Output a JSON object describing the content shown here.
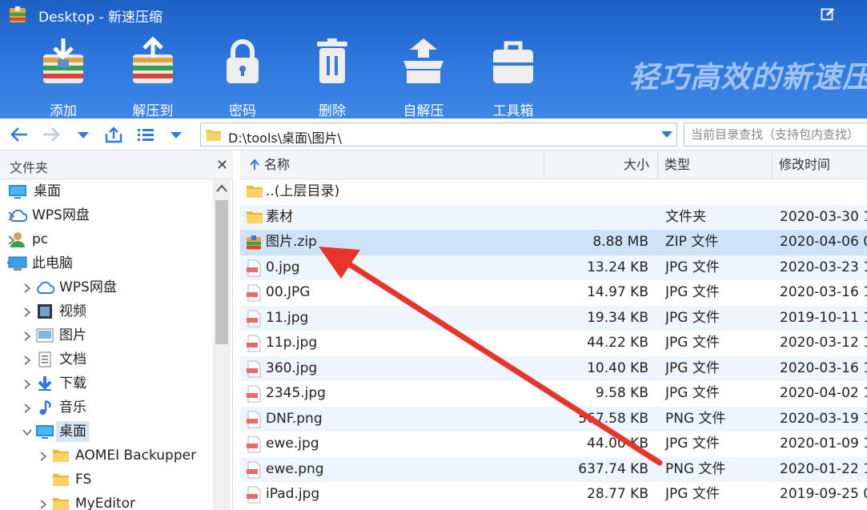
{
  "window": {
    "title": "Desktop - 新速压缩"
  },
  "toolbar": {
    "buttons": [
      {
        "label": "添加",
        "icon": "add-archive-icon"
      },
      {
        "label": "解压到",
        "icon": "extract-icon"
      },
      {
        "label": "密码",
        "icon": "lock-icon"
      },
      {
        "label": "删除",
        "icon": "trash-icon"
      },
      {
        "label": "自解压",
        "icon": "self-extract-icon"
      },
      {
        "label": "工具箱",
        "icon": "toolbox-icon"
      }
    ],
    "slogan": "轻巧高效的新速压"
  },
  "nav": {
    "path": "D:\\tools\\桌面\\图片\\",
    "search_placeholder": "当前目录查找（支持包内查找）"
  },
  "left_pane": {
    "header": "文件夹",
    "close": "✕",
    "tree": [
      {
        "label": "桌面",
        "icon": "desktop-icon",
        "arrow": "none",
        "indent": 0
      },
      {
        "label": "WPS网盘",
        "icon": "cloud-icon",
        "arrow": "right",
        "indent": 0
      },
      {
        "label": "pc",
        "icon": "user-icon",
        "arrow": "right",
        "indent": 0
      },
      {
        "label": "此电脑",
        "icon": "computer-icon",
        "arrow": "down",
        "indent": 0
      },
      {
        "label": "WPS网盘",
        "icon": "cloud-icon",
        "arrow": "right",
        "indent": 1
      },
      {
        "label": "视频",
        "icon": "video-icon",
        "arrow": "right",
        "indent": 1
      },
      {
        "label": "图片",
        "icon": "picture-icon",
        "arrow": "right",
        "indent": 1
      },
      {
        "label": "文档",
        "icon": "document-icon",
        "arrow": "right",
        "indent": 1
      },
      {
        "label": "下载",
        "icon": "download-icon",
        "arrow": "right",
        "indent": 1
      },
      {
        "label": "音乐",
        "icon": "music-icon",
        "arrow": "right",
        "indent": 1
      },
      {
        "label": "桌面",
        "icon": "desktop-icon",
        "arrow": "down",
        "indent": 1,
        "selected": true
      },
      {
        "label": "AOMEI Backupper",
        "icon": "folder-icon",
        "arrow": "right",
        "indent": 2
      },
      {
        "label": "FS",
        "icon": "folder-icon",
        "arrow": "none",
        "indent": 2
      },
      {
        "label": "MyEditor",
        "icon": "folder-icon",
        "arrow": "right",
        "indent": 2
      }
    ]
  },
  "file_list": {
    "columns": {
      "name": "名称",
      "size": "大小",
      "type": "类型",
      "date": "修改时间"
    },
    "rows": [
      {
        "name": "..(上层目录)",
        "size": "",
        "type": "",
        "date": "",
        "icon": "folder-icon"
      },
      {
        "name": "素材",
        "size": "",
        "type": "文件夹",
        "date": "2020-03-30 1",
        "icon": "folder-icon"
      },
      {
        "name": "图片.zip",
        "size": "8.88 MB",
        "type": "ZIP 文件",
        "date": "2020-04-06 0",
        "icon": "zip-icon"
      },
      {
        "name": "0.jpg",
        "size": "13.24 KB",
        "type": "JPG 文件",
        "date": "2020-03-23 1",
        "icon": "image-file-icon"
      },
      {
        "name": "00.JPG",
        "size": "14.97 KB",
        "type": "JPG 文件",
        "date": "2020-03-16 1",
        "icon": "image-file-icon"
      },
      {
        "name": "11.jpg",
        "size": "19.34 KB",
        "type": "JPG 文件",
        "date": "2019-10-11 1",
        "icon": "image-file-icon"
      },
      {
        "name": "11p.jpg",
        "size": "44.22 KB",
        "type": "JPG 文件",
        "date": "2020-03-12 1",
        "icon": "image-file-icon"
      },
      {
        "name": "360.jpg",
        "size": "10.40 KB",
        "type": "JPG 文件",
        "date": "2020-03-16 1",
        "icon": "image-file-icon"
      },
      {
        "name": "2345.jpg",
        "size": "9.58 KB",
        "type": "JPG 文件",
        "date": "2020-04-02 1",
        "icon": "image-file-icon"
      },
      {
        "name": "DNF.png",
        "size": "567.58 KB",
        "type": "PNG 文件",
        "date": "2020-03-19 1",
        "icon": "image-file-icon"
      },
      {
        "name": "ewe.jpg",
        "size": "44.00 KB",
        "type": "JPG 文件",
        "date": "2020-01-09 1",
        "icon": "image-file-icon"
      },
      {
        "name": "ewe.png",
        "size": "637.74 KB",
        "type": "PNG 文件",
        "date": "2020-01-22 1",
        "icon": "image-file-icon"
      },
      {
        "name": "iPad.jpg",
        "size": "28.77 KB",
        "type": "JPG 文件",
        "date": "2019-09-25 0",
        "icon": "image-file-icon"
      }
    ]
  },
  "colors": {
    "header_blue": "#2f79df",
    "annotation_red": "#e8352b",
    "selected_row": "#cfe3f8",
    "alt_row": "#eef5fd"
  }
}
